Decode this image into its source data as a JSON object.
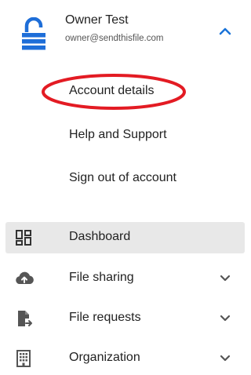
{
  "account": {
    "name": "Owner Test",
    "email": "owner@sendthisfile.com",
    "menu": [
      {
        "label": "Account details"
      },
      {
        "label": "Help and Support"
      },
      {
        "label": "Sign out of account"
      }
    ]
  },
  "nav": {
    "items": [
      {
        "label": "Dashboard",
        "icon": "dashboard-icon",
        "active": true
      },
      {
        "label": "File sharing",
        "icon": "cloud-upload-icon",
        "expandable": true
      },
      {
        "label": "File requests",
        "icon": "file-request-icon",
        "expandable": true
      },
      {
        "label": "Organization",
        "icon": "building-icon",
        "expandable": true
      }
    ]
  },
  "colors": {
    "brand_blue": "#1e6ed8",
    "highlight_red": "#e31b23",
    "active_bg": "#e8e8e8",
    "chevron_blue": "#1a73d8",
    "icon_gray": "#555555"
  }
}
